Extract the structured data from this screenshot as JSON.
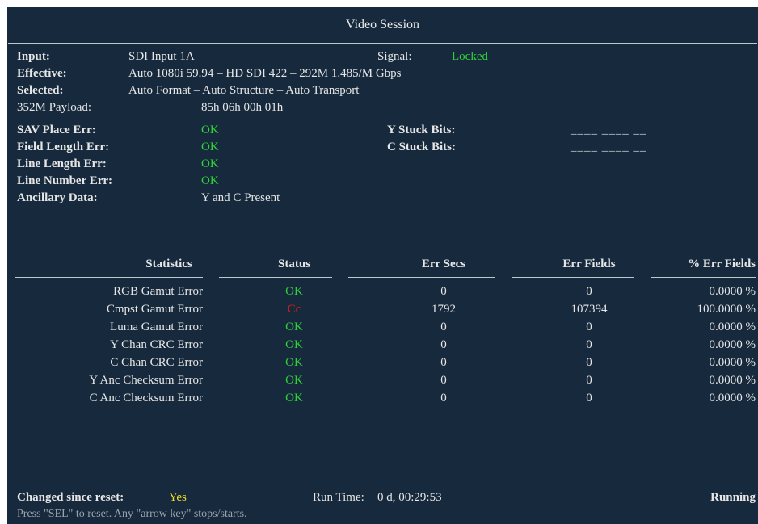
{
  "title": "Video Session",
  "info": {
    "input_label": "Input:",
    "input_value": "SDI Input 1A",
    "signal_label": "Signal:",
    "signal_value": "Locked",
    "effective_label": "Effective:",
    "effective_value": "Auto 1080i 59.94 – HD SDI 422 – 292M 1.485/M Gbps",
    "selected_label": "Selected:",
    "selected_value": "Auto Format – Auto Structure – Auto Transport",
    "payload_label": "352M Payload:",
    "payload_value": "85h 06h 00h 01h"
  },
  "checks": [
    {
      "label": "SAV Place Err:",
      "value": "OK"
    },
    {
      "label": "Field Length Err:",
      "value": "OK"
    },
    {
      "label": "Line Length Err:",
      "value": "OK"
    },
    {
      "label": "Line Number Err:",
      "value": "OK"
    },
    {
      "label": "Ancillary Data:",
      "value": "Y and C Present"
    }
  ],
  "stuck": [
    {
      "label": "Y Stuck Bits:",
      "value": "____ ____ __"
    },
    {
      "label": "C Stuck Bits:",
      "value": "____ ____ __"
    }
  ],
  "table": {
    "headers": [
      "Statistics",
      "Status",
      "Err Secs",
      "Err Fields",
      "% Err Fields"
    ],
    "rows": [
      {
        "name": "RGB Gamut Error",
        "status": "OK",
        "status_kind": "ok",
        "secs": "0",
        "fields": "0",
        "pct": "0.0000 %"
      },
      {
        "name": "Cmpst Gamut Error",
        "status": "Cc",
        "status_kind": "err",
        "secs": "1792",
        "fields": "107394",
        "pct": "100.0000 %"
      },
      {
        "name": "Luma Gamut Error",
        "status": "OK",
        "status_kind": "ok",
        "secs": "0",
        "fields": "0",
        "pct": "0.0000 %"
      },
      {
        "name": "Y Chan CRC Error",
        "status": "OK",
        "status_kind": "ok",
        "secs": "0",
        "fields": "0",
        "pct": "0.0000 %"
      },
      {
        "name": "C Chan CRC Error",
        "status": "OK",
        "status_kind": "ok",
        "secs": "0",
        "fields": "0",
        "pct": "0.0000 %"
      },
      {
        "name": "Y Anc Checksum Error",
        "status": "OK",
        "status_kind": "ok",
        "secs": "0",
        "fields": "0",
        "pct": "0.0000 %"
      },
      {
        "name": "C Anc Checksum Error",
        "status": "OK",
        "status_kind": "ok",
        "secs": "0",
        "fields": "0",
        "pct": "0.0000 %"
      }
    ]
  },
  "footer": {
    "changed_label": "Changed since reset:",
    "changed_value": "Yes",
    "runtime_label": "Run Time:",
    "runtime_value": "0 d, 00:29:53",
    "state": "Running",
    "hint": "Press \"SEL\" to reset.   Any \"arrow key\" stops/starts."
  },
  "colors": {
    "background": "#17293c",
    "ok": "#2fd13a",
    "error": "#d4201a",
    "highlight": "#f0e020"
  }
}
